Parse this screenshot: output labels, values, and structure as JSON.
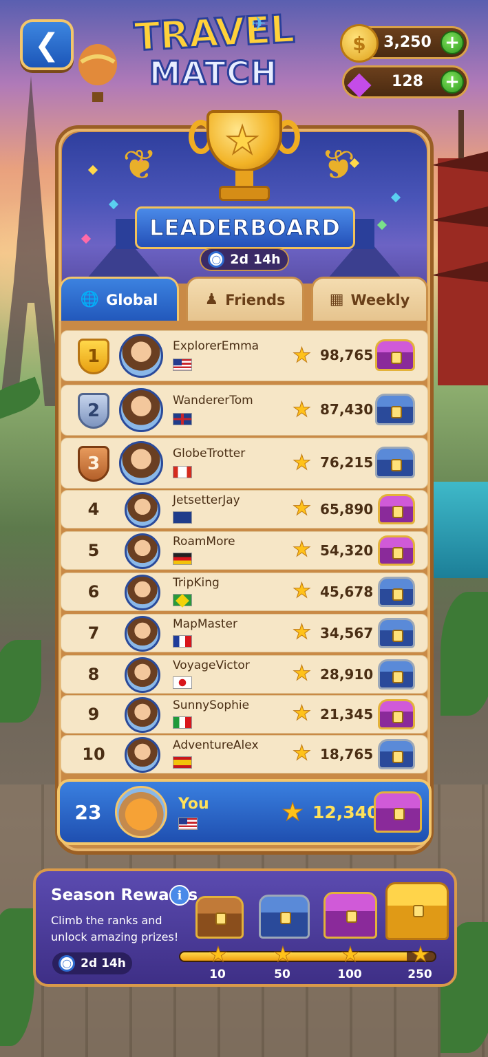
{
  "header": {
    "back_icon": "arrow-left-icon",
    "logo_line1": "TRAVEL",
    "logo_line2": "MATCH",
    "coins": "3,250",
    "gems": "128",
    "coin_icon": "$",
    "plus": "+"
  },
  "leaderboard": {
    "title": "LEADERBOARD",
    "timer": "2d 14h"
  },
  "tabs": [
    {
      "label": "Global",
      "icon": "globe-icon",
      "active": true
    },
    {
      "label": "Friends",
      "icon": "people-icon",
      "active": false
    },
    {
      "label": "Weekly",
      "icon": "calendar-icon",
      "active": false
    }
  ],
  "rows": [
    {
      "rank": "1",
      "name": "ExplorerEmma",
      "flag": "us",
      "score": "98,765",
      "chest": "purple"
    },
    {
      "rank": "2",
      "name": "WandererTom",
      "flag": "uk",
      "score": "87,430",
      "chest": "blue"
    },
    {
      "rank": "3",
      "name": "GlobeTrotter",
      "flag": "ca",
      "score": "76,215",
      "chest": "blue"
    },
    {
      "rank": "4",
      "name": "JetsetterJay",
      "flag": "au",
      "score": "65,890",
      "chest": "purple"
    },
    {
      "rank": "5",
      "name": "RoamMore",
      "flag": "de",
      "score": "54,320",
      "chest": "purple"
    },
    {
      "rank": "6",
      "name": "TripKing",
      "flag": "br",
      "score": "45,678",
      "chest": "blue"
    },
    {
      "rank": "7",
      "name": "MapMaster",
      "flag": "fr",
      "score": "34,567",
      "chest": "blue"
    },
    {
      "rank": "8",
      "name": "VoyageVictor",
      "flag": "jp",
      "score": "28,910",
      "chest": "blue"
    },
    {
      "rank": "9",
      "name": "SunnySophie",
      "flag": "it",
      "score": "21,345",
      "chest": "purple"
    },
    {
      "rank": "10",
      "name": "AdventureAlex",
      "flag": "es",
      "score": "18,765",
      "chest": "blue"
    }
  ],
  "you": {
    "rank": "23",
    "name": "You",
    "flag": "us",
    "score": "12,340",
    "chest": "purple"
  },
  "season": {
    "title": "Season Rewards",
    "info": "i",
    "desc": "Climb the ranks and unlock amazing prizes!",
    "timer": "2d 14h",
    "progress": 0.89,
    "milestones": [
      "10",
      "50",
      "100",
      "250"
    ],
    "chests": [
      "wood",
      "blue",
      "purple",
      "gold"
    ]
  },
  "colors": {
    "accent_blue": "#2258bb",
    "gold": "#ffc21a",
    "panel_wood": "#c98a46"
  }
}
